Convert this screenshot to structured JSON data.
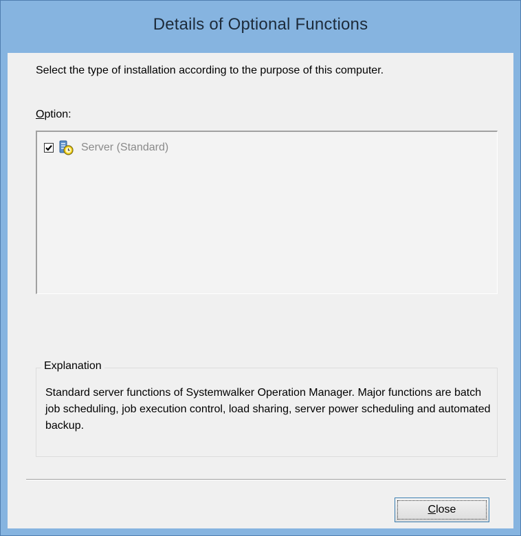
{
  "window": {
    "title": "Details of Optional Functions"
  },
  "instruction": {
    "text": "Select the type of installation according to the purpose of this computer."
  },
  "option": {
    "label_mnemonic": "O",
    "label_rest": "ption:",
    "items": [
      {
        "label": "Server (Standard)",
        "checked": true,
        "icon": "server-icon"
      }
    ]
  },
  "explanation": {
    "title": "Explanation",
    "text": "Standard server functions of Systemwalker Operation Manager. Major functions are batch job scheduling, job execution control, load sharing, server power scheduling and automated backup."
  },
  "buttons": {
    "close_mnemonic": "C",
    "close_rest": "lose"
  },
  "colors": {
    "frame": "#86b4e0",
    "client": "#f0f0f0",
    "disabled_text": "#8a8a8a",
    "button_border": "#3c7fb1"
  }
}
